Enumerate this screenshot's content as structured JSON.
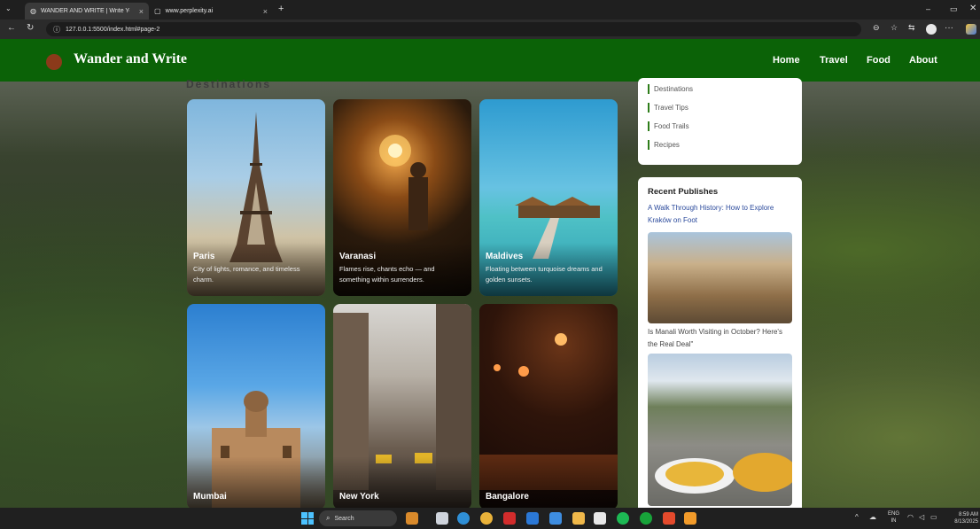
{
  "browser": {
    "tabs": [
      {
        "title": "WANDER AND WRITE | Write Your",
        "close": "×"
      },
      {
        "title": "www.perplexity.ai",
        "close": "×"
      }
    ],
    "new_tab": "+",
    "url": "127.0.0.1:5500/index.html#page-2"
  },
  "site": {
    "brand": "Wander and Write",
    "nav": [
      "Home",
      "Travel",
      "Food",
      "About"
    ],
    "section_title": "Destinations",
    "colors": {
      "nav_green": "#0b6207",
      "accent_green": "#2e7d1a"
    },
    "cards": [
      {
        "name": "Paris",
        "desc": "City of lights, romance, and timeless charm."
      },
      {
        "name": "Varanasi",
        "desc": "Flames rise, chants echo — and something within surrenders."
      },
      {
        "name": "Maldives",
        "desc": "Floating between turquoise dreams and golden sunsets."
      },
      {
        "name": "Mumbai",
        "desc": ""
      },
      {
        "name": "New York",
        "desc": ""
      },
      {
        "name": "Bangalore",
        "desc": ""
      }
    ],
    "sidebar": {
      "categories": [
        "Destinations",
        "Travel Tips",
        "Food Trails",
        "Recipes"
      ],
      "recent_title": "Recent Publishes",
      "posts": [
        "A Walk Through History: How to Explore Kraków on Foot",
        "Is Manali Worth Visiting in October? Here's the Real Deal\""
      ]
    }
  },
  "taskbar": {
    "search_placeholder": "Search",
    "lang": "ENG",
    "region": "IN",
    "time": "8:59 AM",
    "date": "8/13/2025"
  }
}
